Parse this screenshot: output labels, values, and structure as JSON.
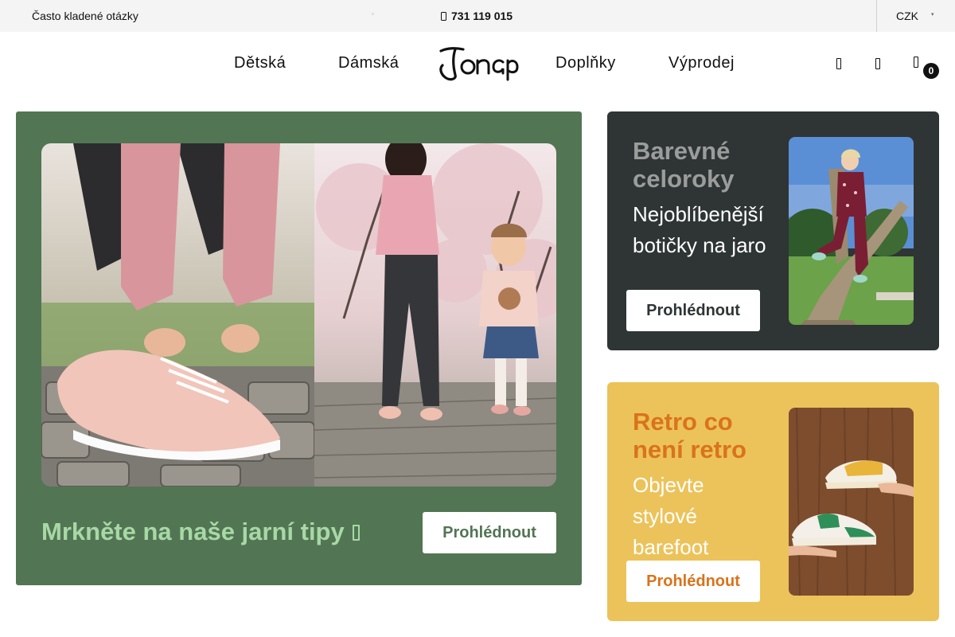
{
  "topbar": {
    "faq": "Často kladené otázky",
    "phone": "731 119 015",
    "currency": "CZK"
  },
  "nav": {
    "left": [
      "Dětská",
      "Dámská"
    ],
    "right": [
      "Doplňky",
      "Výprodej"
    ],
    "logo_text": "Jonap",
    "cart_count": "0",
    "icons": [
      "search-icon",
      "account-icon",
      "cart-icon"
    ]
  },
  "hero": {
    "title": "Mrkněte na naše jarní tipy",
    "button": "Prohlédnout",
    "bg_color": "#527554",
    "title_color": "#a8d8a6"
  },
  "cards": [
    {
      "title": "Barevné celoroky",
      "subtitle": "Nejoblíbenější botičky na jaro",
      "button": "Prohlédnout",
      "bg_color": "#2f3435"
    },
    {
      "title": "Retro co není retro",
      "subtitle": "Objevte stylové barefoot",
      "button": "Prohlédnout",
      "bg_color": "#ecc35a",
      "accent_color": "#d9731c"
    }
  ]
}
